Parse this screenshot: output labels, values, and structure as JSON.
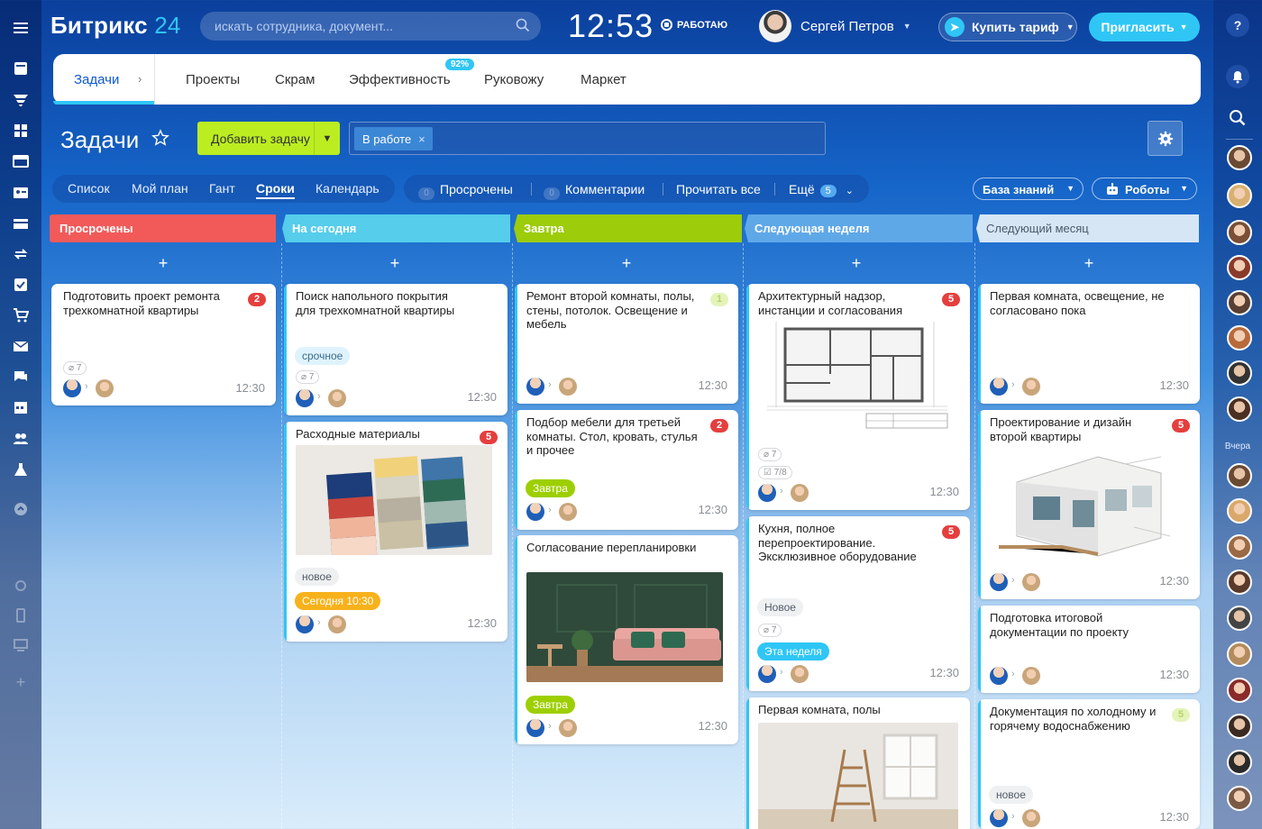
{
  "header": {
    "logo_text": "Битрикс",
    "logo_num": "24",
    "search_placeholder": "искать сотрудника, документ...",
    "clock": "12:53",
    "work_status": "РАБОТАЮ",
    "user_name": "Сергей Петров",
    "buy_label": "Купить тариф",
    "invite_label": "Пригласить"
  },
  "topnav": {
    "items": [
      "Задачи",
      "Проекты",
      "Скрам",
      "Эффективность",
      "Руковожу",
      "Маркет"
    ],
    "efficiency_badge": "92%"
  },
  "page": {
    "title": "Задачи",
    "add_task": "Добавить задачу",
    "filter_chip": "В работе",
    "views": [
      "Список",
      "Мой план",
      "Гант",
      "Сроки",
      "Календарь"
    ],
    "active_view": "Сроки",
    "counters": {
      "overdue": "Просрочены",
      "overdue_count": "0",
      "comments": "Комментарии",
      "comments_count": "0",
      "read_all": "Прочитать все",
      "more": "Ещё",
      "more_count": "5"
    },
    "knowledge_base": "База знаний",
    "robots": "Роботы"
  },
  "right_rail": {
    "yesterday_label": "Вчера"
  },
  "colors": {
    "accent": "#2fc6f6",
    "add_task": "#bbed21",
    "red": "#e53e3e"
  },
  "columns": [
    {
      "title": "Просрочены",
      "color": "#f25a5a",
      "cards": [
        {
          "title": "Подготовить проект ремонта трехкомнатной квартиры",
          "badge": "2",
          "attach": "7",
          "time": "12:30"
        }
      ]
    },
    {
      "title": "На сегодня",
      "color": "#55cdeb",
      "cards": [
        {
          "title": "Поиск напольного покрытия для трехкомнатной квартиры",
          "tag": "срочное",
          "attach": "7",
          "time": "12:30"
        },
        {
          "title": "Расходные материалы",
          "badge": "5",
          "tag1": "новое",
          "tag2": "Сегодня 10:30",
          "time": "12:30"
        }
      ]
    },
    {
      "title": "Завтра",
      "color": "#9ccc0a",
      "cards": [
        {
          "title": "Ремонт второй комнаты, полы, стены, потолок. Освещение и  мебель",
          "badge": "1",
          "time": "12:30"
        },
        {
          "title": "Подбор мебели для третьей комнаты. Стол, кровать, стулья и прочее",
          "badge": "2",
          "tag": "Завтра",
          "time": "12:30"
        },
        {
          "title": "Согласование перепланировки",
          "tag": "Завтра",
          "time": "12:30"
        }
      ]
    },
    {
      "title": "Следующая неделя",
      "color": "#5fa8e8",
      "cards": [
        {
          "title": "Архитектурный надзор, инстанции и согласования",
          "badge": "5",
          "attach": "7",
          "checks": "7/8",
          "time": "12:30"
        },
        {
          "title": "Кухня, полное перепроектирование. Эксклюзивное оборудование",
          "badge": "5",
          "tag1": "Новое",
          "attach": "7",
          "tag2": "Эта неделя",
          "time": "12:30"
        },
        {
          "title": "Первая комната, полы"
        }
      ]
    },
    {
      "title": "Следующий месяц",
      "color": "#d6e6f5",
      "cards": [
        {
          "title": "Первая комната, освещение, не согласовано пока",
          "time": "12:30"
        },
        {
          "title": "Проектирование и дизайн второй квартиры",
          "badge": "5",
          "time": "12:30"
        },
        {
          "title": "Подготовка итоговой документации по проекту",
          "time": "12:30"
        },
        {
          "title": "Документация по холодному и горячему водоснабжению",
          "badge": "5",
          "tag": "новое",
          "time": "12:30"
        }
      ]
    }
  ]
}
